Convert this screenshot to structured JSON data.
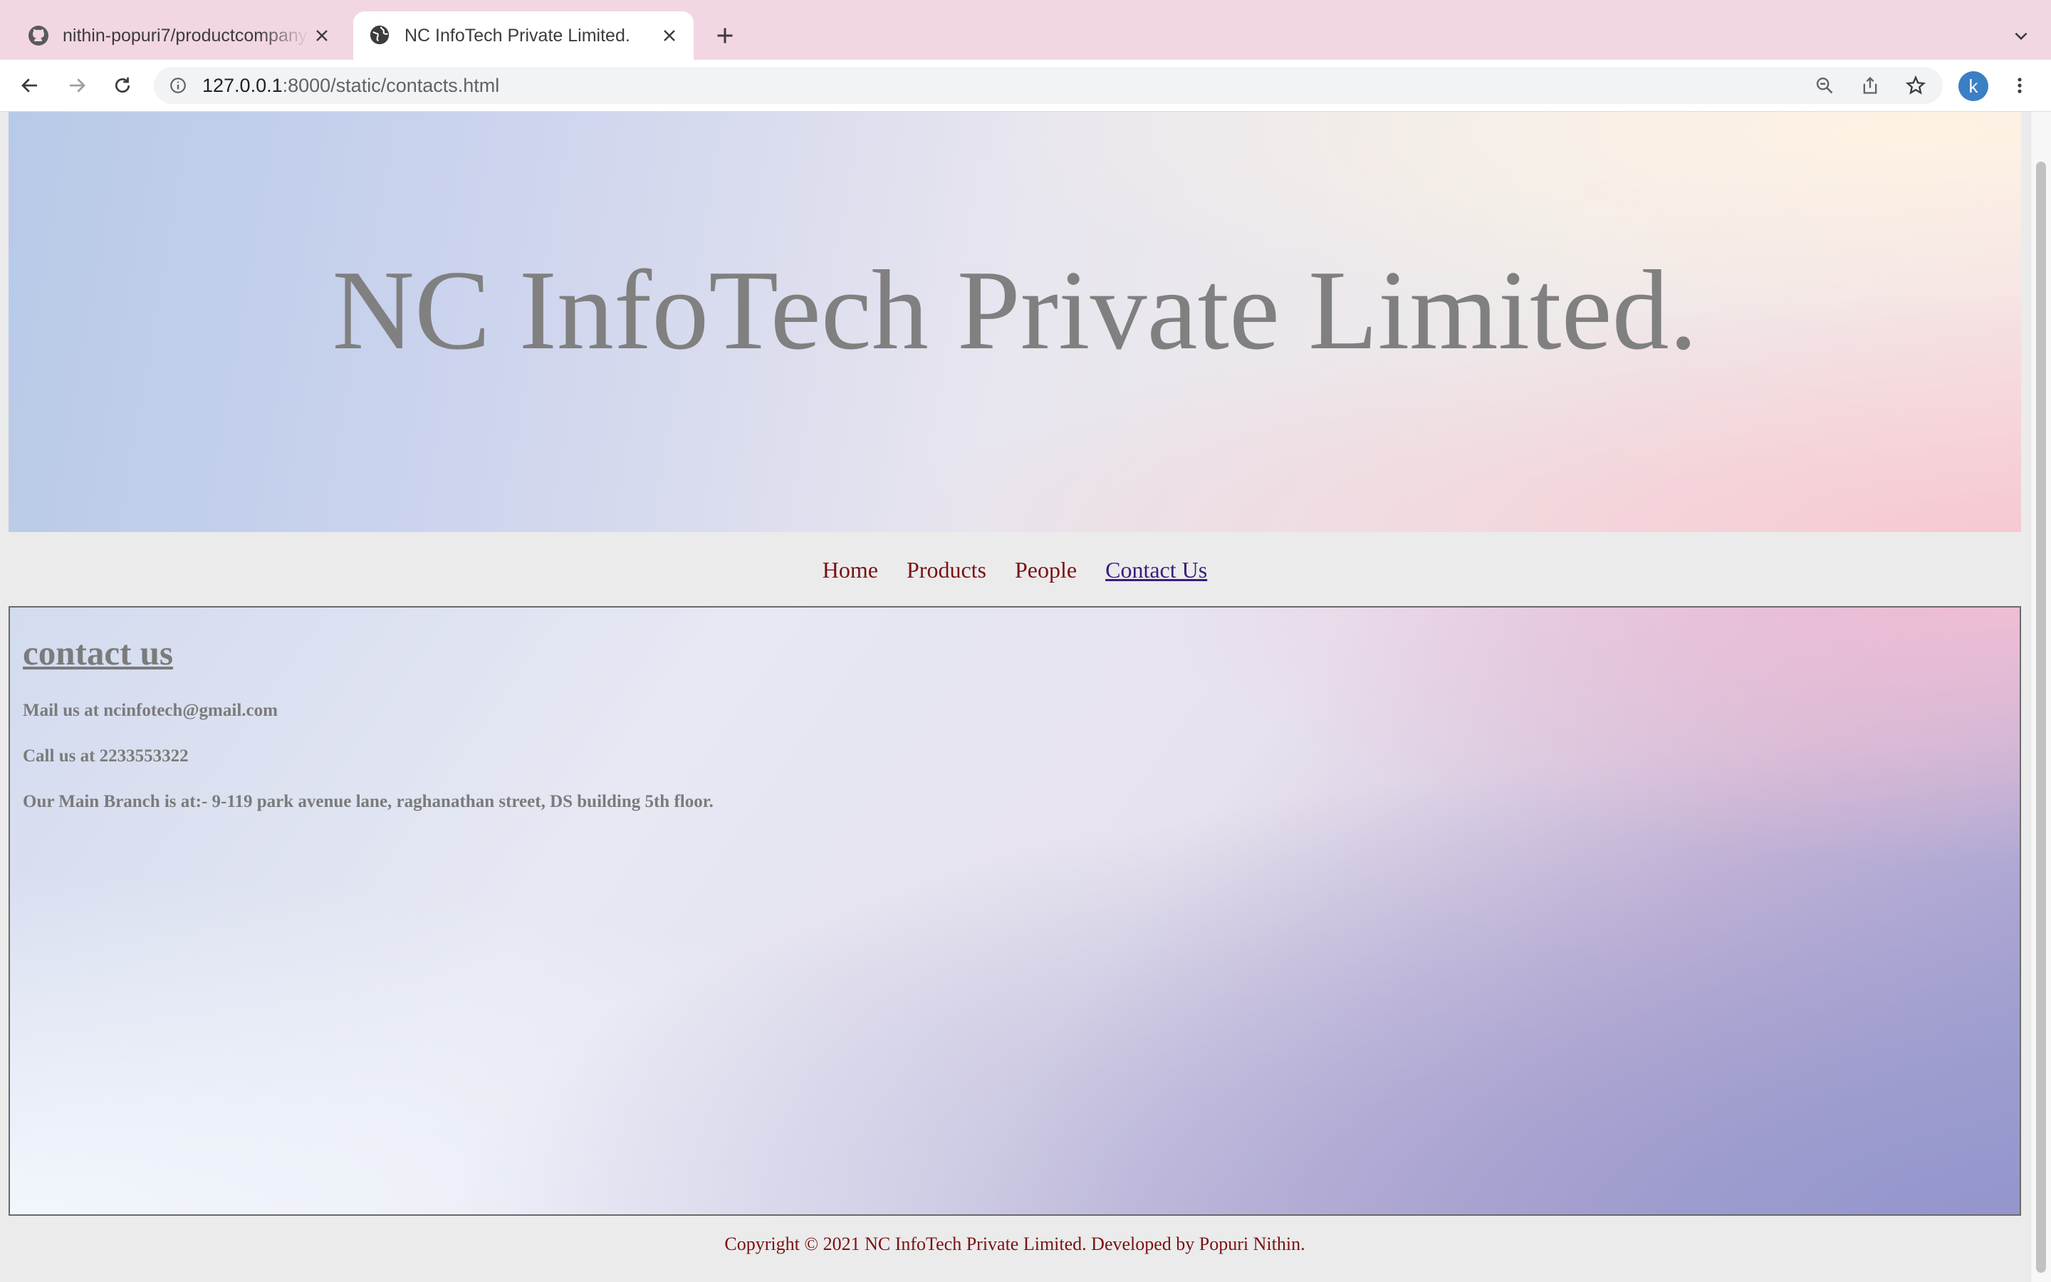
{
  "browser": {
    "tabs": [
      {
        "title": "nithin-popuri7/productcompany",
        "active": false,
        "icon": "github-icon"
      },
      {
        "title": "NC InfoTech Private Limited.",
        "active": true,
        "icon": "globe-icon"
      }
    ],
    "address_bar": {
      "host": "127.0.0.1",
      "path": ":8000/static/contacts.html"
    },
    "profile_initial": "k"
  },
  "page": {
    "hero_title": "NC InfoTech Private Limited.",
    "nav": [
      {
        "label": "Home"
      },
      {
        "label": "Products"
      },
      {
        "label": "People"
      },
      {
        "label": "Contact Us",
        "current": true
      }
    ],
    "contact": {
      "heading": "contact us",
      "mail": "Mail us at ncinfotech@gmail.com",
      "call": "Call us at 2233553322",
      "branch": "Our Main Branch is at:- 9-119 park avenue lane, raghanathan street, DS building 5th floor."
    },
    "footer": "Copyright © 2021 NC InfoTech Private Limited. Developed by Popuri Nithin."
  },
  "colors": {
    "tabstrip": "#f2d6e4",
    "nav_link": "#7b1113",
    "nav_current": "#3a1d7d",
    "text_gray": "#7b7b7b"
  }
}
